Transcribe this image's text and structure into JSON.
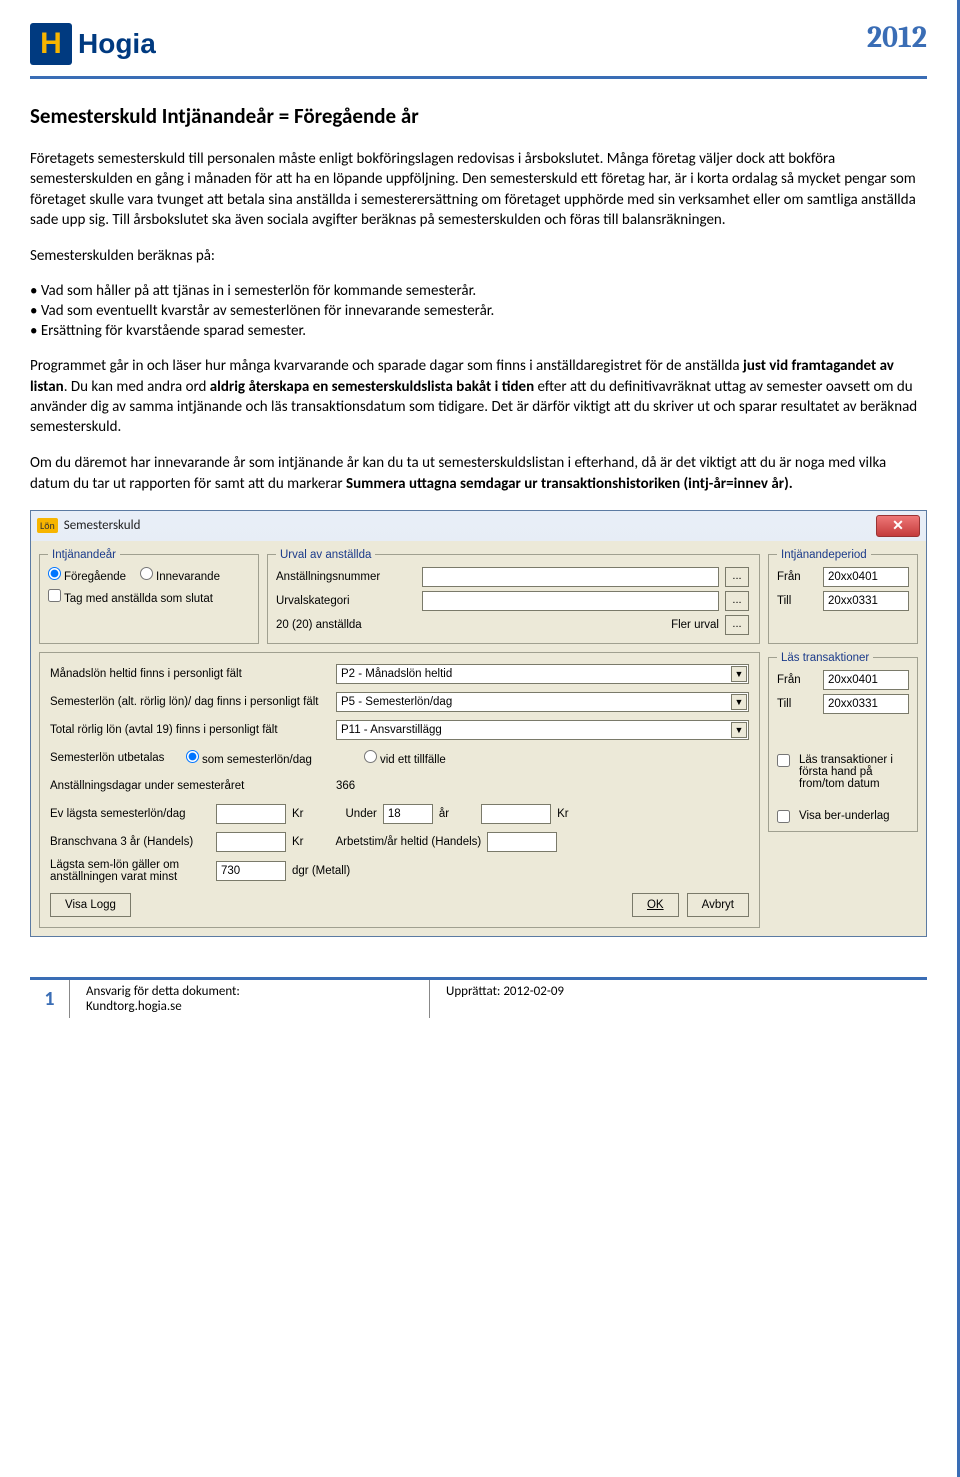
{
  "header": {
    "brand": "Hogia",
    "year": "2012"
  },
  "doc": {
    "title": "Semesterskuld Intjänandeår = Föregående år",
    "p1": "Företagets semesterskuld till personalen måste enligt bokföringslagen redovisas i årsbokslutet. Många företag väljer dock att bokföra semesterskulden en gång i månaden för att ha en löpande uppföljning. Den semesterskuld ett företag har, är i korta ordalag så mycket pengar som företaget skulle vara tvunget att betala sina anställda i semesterersättning om företaget upphörde med sin verksamhet eller om samtliga anställda sade upp sig. Till årsbokslutet ska även sociala avgifter beräknas på semesterskulden och föras till balansräkningen.",
    "p2": "Semesterskulden beräknas på:",
    "bullets": {
      "b1": "• Vad som håller på att tjänas in i semesterlön för kommande semesterår.",
      "b2": "• Vad som eventuellt kvarstår av semesterlönen för innevarande semesterår.",
      "b3": "• Ersättning för kvarstående sparad semester."
    },
    "p3a": "Programmet går in och läser hur många kvarvarande och sparade dagar som finns i anställdaregistret för de anställda ",
    "p3b": "just vid framtagandet av listan",
    "p3c": ". Du kan med andra ord ",
    "p3d": "aldrig återskapa en semesterskuldslista bakåt i tiden",
    "p3e": " efter att du definitivavräknat uttag av semester oavsett om du använder dig av samma intjänande och läs transaktionsdatum som tidigare.  Det är därför viktigt att du skriver ut och sparar resultatet av beräknad semesterskuld.",
    "p4a": "Om du däremot har innevarande år som intjänande år kan du ta ut semesterskuldslistan i efterhand, då är det viktigt att du är noga med vilka datum du tar ut rapporten för samt att du markerar ",
    "p4b": "Summera uttagna semdagar ur transaktionshistoriken (intj-år=innev år)."
  },
  "dialog": {
    "title": "Semesterskuld",
    "lon": "Lön",
    "intj": {
      "legend": "Intjänandeår",
      "opt1": "Föregående",
      "opt2": "Innevarande",
      "chk": "Tag med anställda som slutat"
    },
    "urval": {
      "legend": "Urval av anställda",
      "row1": "Anställningsnummer",
      "row2": "Urvalskategori",
      "count": "20 (20) anställda",
      "fler": "Fler urval"
    },
    "period": {
      "legend": "Intjänandeperiod",
      "from": "Från",
      "from_v": "20xx0401",
      "till": "Till",
      "till_v": "20xx0331"
    },
    "settings": {
      "s1": "Månadslön heltid finns i personligt fält",
      "s1v": "P2 - Månadslön heltid",
      "s2": "Semesterlön (alt. rörlig lön)/ dag finns i personligt fält",
      "s2v": "P5 - Semesterlön/dag",
      "s3": "Total rörlig lön (avtal 19)  finns i personligt fält",
      "s3v": "P11 - Ansvarstillägg",
      "s4": "Semesterlön utbetalas",
      "s4r1": "som semesterlön/dag",
      "s4r2": "vid ett tillfälle",
      "s5": "Anställningsdagar under semesteråret",
      "s5v": "366",
      "s6": "Ev lägsta semesterlön/dag",
      "kr": "Kr",
      "under": "Under",
      "under_v": "18",
      "ar": "år",
      "s7": "Branschvana 3 år (Handels)",
      "s7b": "Arbetstim/år heltid (Handels)",
      "s8a": "Lägsta sem-lön gäller om anställningen varat minst",
      "s8v": "730",
      "s8u": "dgr (Metall)"
    },
    "las": {
      "legend": "Läs transaktioner",
      "from": "Från",
      "from_v": "20xx0401",
      "till": "Till",
      "till_v": "20xx0331",
      "chk1": "Läs transaktioner i första hand på from/tom datum",
      "chk2": "Visa ber-underlag"
    },
    "buttons": {
      "logg": "Visa Logg",
      "ok": "OK",
      "avbryt": "Avbryt"
    }
  },
  "footer": {
    "page": "1",
    "resp_label": "Ansvarig för detta dokument:",
    "resp_value": "Kundtorg.hogia.se",
    "date_label": "Upprättat: 2012-02-09"
  }
}
